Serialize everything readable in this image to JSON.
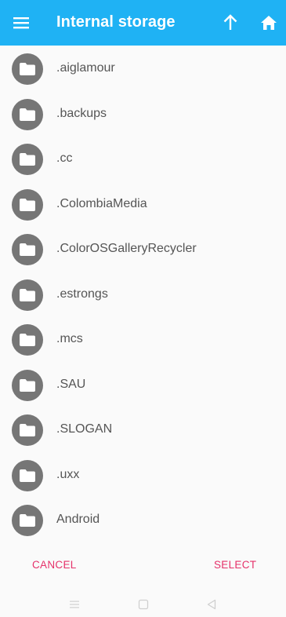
{
  "appbar": {
    "title": "Internal storage",
    "menu_icon": "hamburger-menu-icon",
    "up_icon": "arrow-up-icon",
    "home_icon": "home-icon",
    "background_color": "#1fb2f4"
  },
  "folders": [
    {
      "name": ".aiglamour"
    },
    {
      "name": ".backups"
    },
    {
      "name": ".cc"
    },
    {
      "name": ".ColombiaMedia"
    },
    {
      "name": ".ColorOSGalleryRecycler"
    },
    {
      "name": ".estrongs"
    },
    {
      "name": ".mcs"
    },
    {
      "name": ".SAU"
    },
    {
      "name": ".SLOGAN"
    },
    {
      "name": ".uxx"
    },
    {
      "name": "Android"
    }
  ],
  "footer": {
    "cancel_label": "CANCEL",
    "select_label": "SELECT",
    "accent_color": "#e5316a"
  },
  "system_nav": {
    "menu_icon": "recent-apps-icon",
    "home_icon": "home-square-icon",
    "back_icon": "back-triangle-icon"
  }
}
